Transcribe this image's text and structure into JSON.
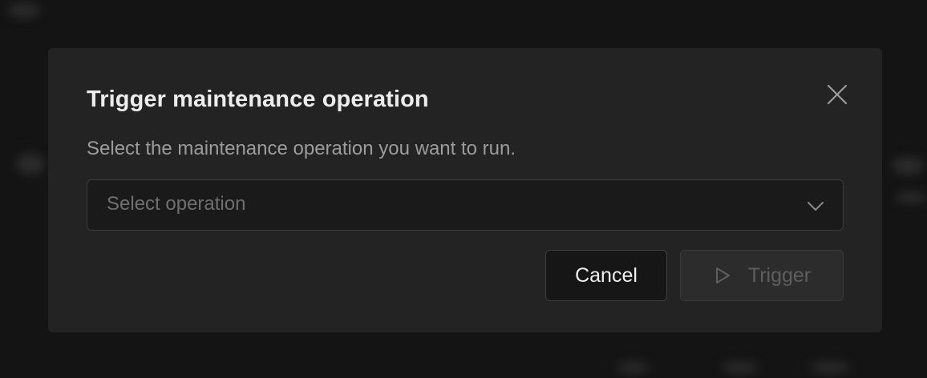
{
  "dialog": {
    "title": "Trigger maintenance operation",
    "description": "Select the maintenance operation you want to run.",
    "select": {
      "placeholder": "Select operation",
      "value": ""
    },
    "buttons": {
      "cancel_label": "Cancel",
      "trigger_label": "Trigger"
    },
    "icons": {
      "close": "close-icon",
      "chevron": "chevron-down-icon",
      "trigger": "play-icon"
    }
  },
  "colors": {
    "overlay": "#141414",
    "dialog_bg": "#232323",
    "title": "#ededed",
    "description": "#9c9c9c",
    "placeholder": "#6f6f6f",
    "disabled_text": "#5e5e5e"
  }
}
